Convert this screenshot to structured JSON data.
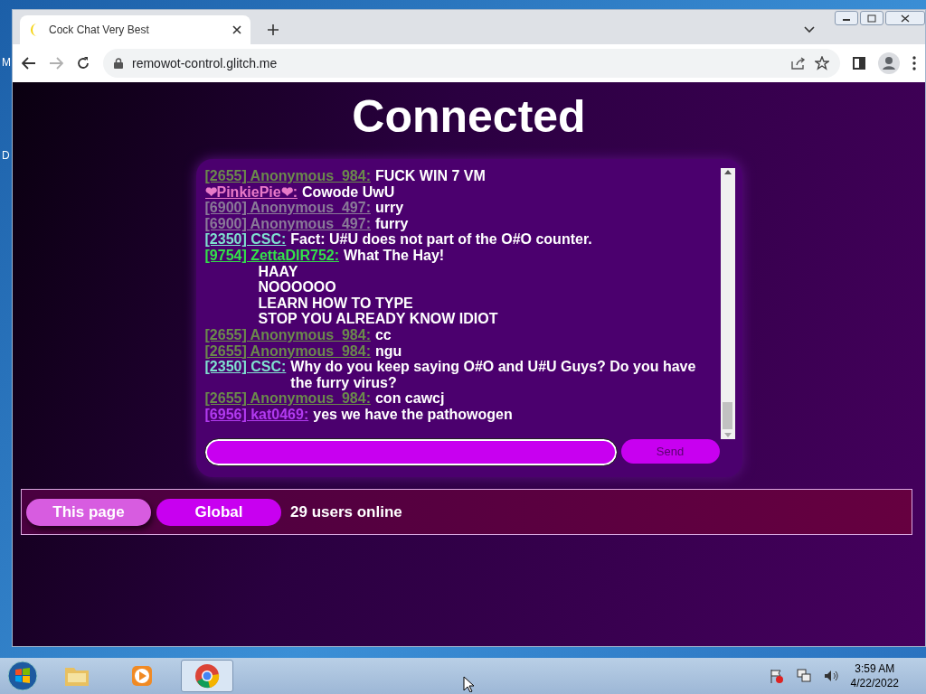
{
  "desktop_labels": [
    "M",
    "D"
  ],
  "browser": {
    "tab": {
      "title": "Cock Chat Very Best"
    },
    "address": "remowot-control.glitch.me",
    "forward_disabled": true
  },
  "page": {
    "heading": "Connected",
    "messages": [
      {
        "kind": "message",
        "name": "[2655] Anonymous_984:",
        "color": "#6b8a4c",
        "text": "FUCK WIN 7 VM"
      },
      {
        "kind": "message",
        "name": "❤PinkiePie❤:",
        "color": "#e87ac8",
        "text": "Cowode UwU"
      },
      {
        "kind": "message",
        "name": "[6900] Anonymous_497:",
        "color": "#8a7a98",
        "text": "urry"
      },
      {
        "kind": "message",
        "name": "[6900] Anonymous_497:",
        "color": "#8a7a98",
        "text": "furry"
      },
      {
        "kind": "message",
        "name": "[2350] CSC:",
        "color": "#7fe0cf",
        "text": "Fact: U#U does not part of the O#O counter."
      },
      {
        "kind": "message",
        "name": "[9754] ZettaDIR752:",
        "color": "#33e04a",
        "text": "What The Hay!"
      },
      {
        "kind": "continuation",
        "text": "HAAY"
      },
      {
        "kind": "continuation",
        "text": "NOOOOOO"
      },
      {
        "kind": "continuation",
        "text": "LEARN HOW TO TYPE"
      },
      {
        "kind": "continuation",
        "text": "STOP YOU ALREADY KNOW IDIOT"
      },
      {
        "kind": "message",
        "name": "[2655] Anonymous_984:",
        "color": "#6b8a4c",
        "text": "cc"
      },
      {
        "kind": "message",
        "name": "[2655] Anonymous_984:",
        "color": "#6b8a4c",
        "text": "ngu"
      },
      {
        "kind": "message",
        "name": "[2350] CSC:",
        "color": "#7fe0cf",
        "text": "Why do you keep saying O#O and U#U Guys? Do you have the furry virus?"
      },
      {
        "kind": "message",
        "name": "[2655] Anonymous_984:",
        "color": "#6b8a4c",
        "text": "con cawcj"
      },
      {
        "kind": "message",
        "name": "[6956] kat0469:",
        "color": "#b23af0",
        "text": "yes we have the pathowogen"
      }
    ],
    "send_button": "Send",
    "scopes": [
      {
        "label": "This page",
        "selected": true
      },
      {
        "label": "Global",
        "selected": false
      }
    ],
    "online": "29 users online"
  },
  "taskbar": {
    "time": "3:59 AM",
    "date": "4/22/2022"
  }
}
